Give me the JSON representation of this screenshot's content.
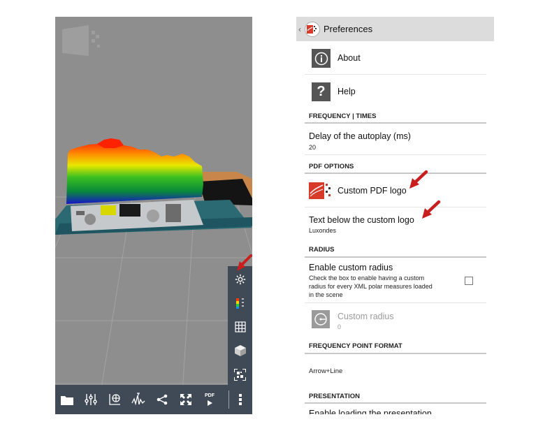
{
  "viewer": {
    "side_toolbar": [
      {
        "name": "settings-gear-icon",
        "icon": "gear"
      },
      {
        "name": "color-scale-icon",
        "icon": "color-scale"
      },
      {
        "name": "grid-icon",
        "icon": "grid"
      },
      {
        "name": "cube-view-icon",
        "icon": "cube"
      },
      {
        "name": "qr-code-icon",
        "icon": "qr-code"
      }
    ],
    "bottom_bar": [
      {
        "name": "folder-icon",
        "icon": "folder"
      },
      {
        "name": "equalizer-icon",
        "icon": "sliders"
      },
      {
        "name": "polar-axis-icon",
        "icon": "polar-axis"
      },
      {
        "name": "waveform-icon",
        "icon": "waveform"
      },
      {
        "name": "share-icon",
        "icon": "share"
      },
      {
        "name": "fullscreen-icon",
        "icon": "fullscreen"
      },
      {
        "name": "pdf-play-icon",
        "icon": "pdf-play"
      },
      {
        "name": "overflow-menu-icon",
        "icon": "more-vert"
      }
    ],
    "pdf_button_text": "PDF",
    "accent_colors": {
      "toolbar": "#3f4a56",
      "arrow": "#c81e1e"
    }
  },
  "preferences": {
    "title": "Preferences",
    "items": {
      "about": {
        "label": "About",
        "icon": "info-icon"
      },
      "help": {
        "label": "Help",
        "icon": "question-icon"
      }
    },
    "categories": {
      "frequency_times": "FREQUENCY | TIMES",
      "pdf_options": "PDF OPTIONS",
      "radius": "RADIUS",
      "frequency_point_format": "FREQUENCY POINT FORMAT",
      "presentation": "PRESENTATION"
    },
    "autoplay_delay": {
      "title": "Delay of the autoplay (ms)",
      "value": "20"
    },
    "custom_pdf_logo": {
      "title": "Custom PDF logo"
    },
    "text_below_logo": {
      "title": "Text below the custom logo",
      "value": "Luxondes"
    },
    "enable_custom_radius": {
      "title": "Enable custom radius",
      "summary": "Check the box to enable having a custom radius for every XML polar measures loaded in the scene",
      "summary_lines": [
        "Check the box to enable having a custom",
        "radius for every XML polar measures loaded",
        "in the scene"
      ],
      "checked": false
    },
    "custom_radius": {
      "title": "Custom radius",
      "value": "0",
      "enabled": false
    },
    "frequency_point_value": "Arrow+Line",
    "enable_presentation_partial": "Enable loading the presentation"
  }
}
